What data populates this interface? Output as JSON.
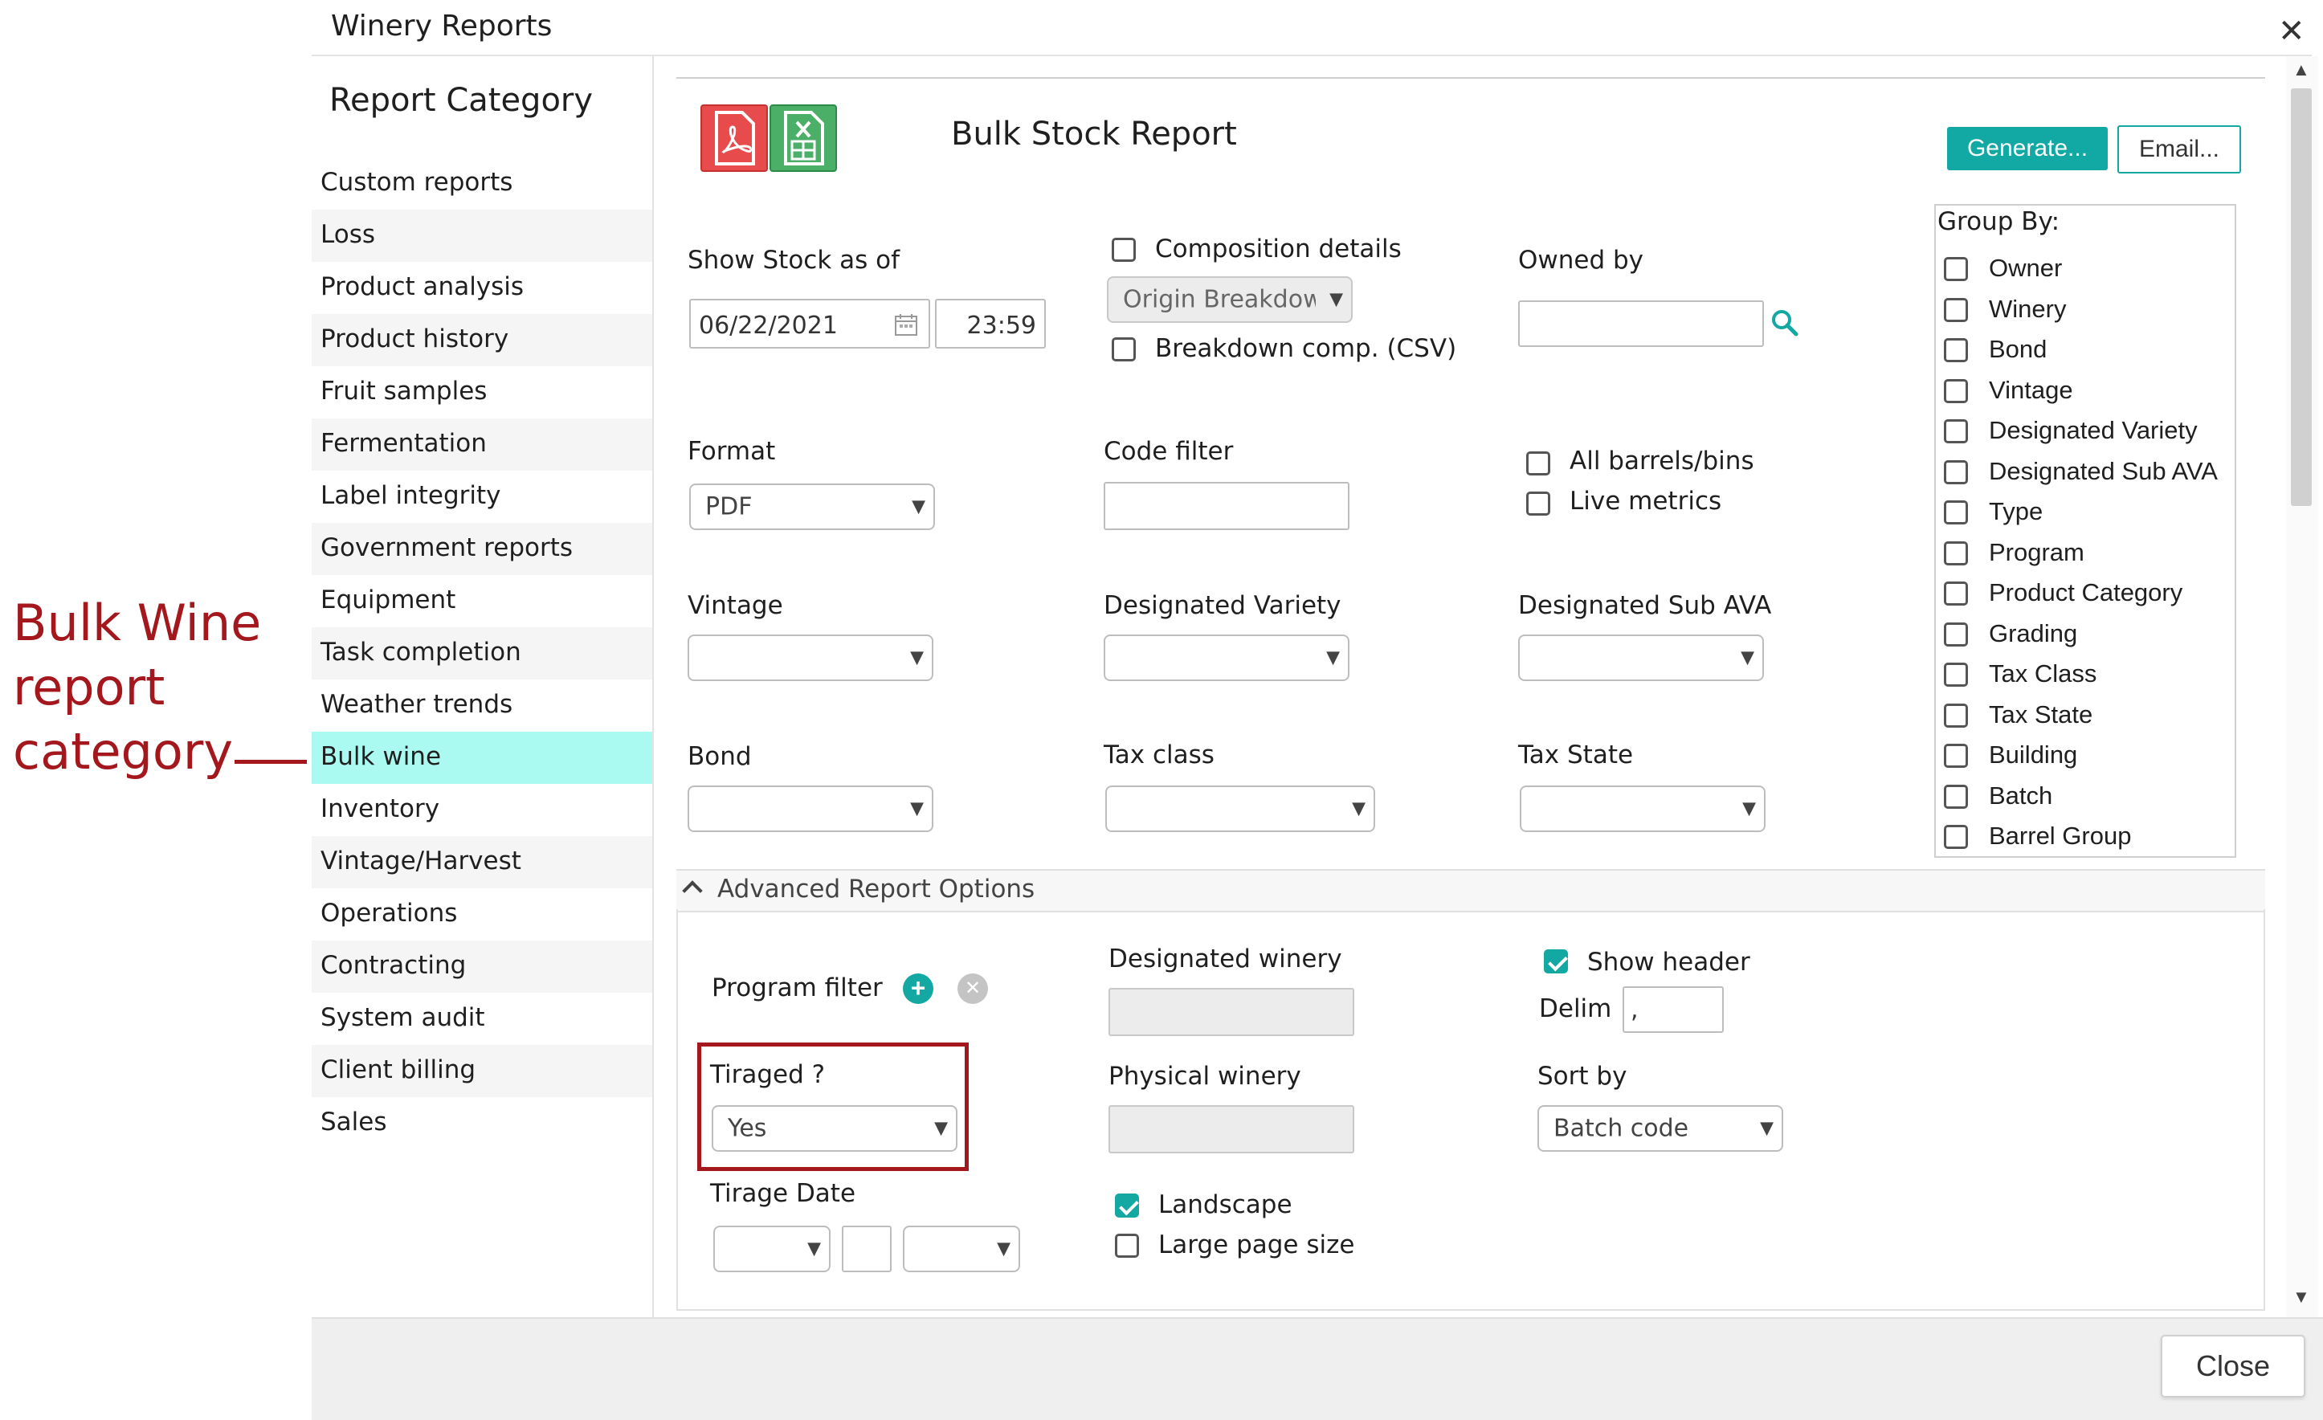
{
  "annotation": {
    "text": "Bulk Wine report category",
    "color": "#a3171d"
  },
  "dialog": {
    "title": "Winery Reports",
    "close_symbol": "✕"
  },
  "sidebar": {
    "heading": "Report Category",
    "items": [
      {
        "label": "Custom reports"
      },
      {
        "label": "Loss"
      },
      {
        "label": "Product analysis"
      },
      {
        "label": "Product history"
      },
      {
        "label": "Fruit samples"
      },
      {
        "label": "Fermentation"
      },
      {
        "label": "Label integrity"
      },
      {
        "label": "Government reports"
      },
      {
        "label": "Equipment"
      },
      {
        "label": "Task completion"
      },
      {
        "label": "Weather trends"
      },
      {
        "label": "Bulk wine",
        "active": true
      },
      {
        "label": "Inventory"
      },
      {
        "label": "Vintage/Harvest"
      },
      {
        "label": "Operations"
      },
      {
        "label": "Contracting"
      },
      {
        "label": "System audit"
      },
      {
        "label": "Client billing"
      },
      {
        "label": "Sales"
      }
    ],
    "active_color": "#aafaf2"
  },
  "report": {
    "title": "Bulk Stock Report",
    "icons": {
      "pdf": "pdf-file-icon",
      "excel": "excel-file-icon"
    },
    "generate_label": "Generate...",
    "email_label": "Email...",
    "accent_color": "#12a9a4"
  },
  "fields": {
    "show_stock_label": "Show Stock as of",
    "date_value": "06/22/2021",
    "time_value": "23:59",
    "composition_label": "Composition details",
    "origin_breakdown_value": "Origin Breakdown",
    "breakdown_csv_label": "Breakdown comp. (CSV)",
    "owned_by_label": "Owned by",
    "owned_by_value": "",
    "format_label": "Format",
    "format_value": "PDF",
    "code_filter_label": "Code filter",
    "code_filter_value": "",
    "all_barrels_label": "All barrels/bins",
    "live_metrics_label": "Live metrics",
    "vintage_label": "Vintage",
    "designated_variety_label": "Designated Variety",
    "designated_sub_ava_label": "Designated Sub AVA",
    "bond_label": "Bond",
    "tax_class_label": "Tax class",
    "tax_state_label": "Tax State"
  },
  "group_by": {
    "heading": "Group By:",
    "items": [
      "Owner",
      "Winery",
      "Bond",
      "Vintage",
      "Designated Variety",
      "Designated Sub AVA",
      "Type",
      "Program",
      "Product Category",
      "Grading",
      "Tax Class",
      "Tax State",
      "Building",
      "Batch",
      "Barrel Group"
    ]
  },
  "advanced": {
    "toggle_label": "Advanced Report Options",
    "program_filter_label": "Program filter",
    "tiraged_label": "Tiraged ?",
    "tiraged_value": "Yes",
    "tirage_date_label": "Tirage Date",
    "designated_winery_label": "Designated winery",
    "physical_winery_label": "Physical winery",
    "landscape_label": "Landscape",
    "landscape_checked": true,
    "large_page_label": "Large page size",
    "show_header_label": "Show header",
    "show_header_checked": true,
    "delim_label": "Delim",
    "delim_value": ",",
    "sort_by_label": "Sort by",
    "sort_by_value": "Batch code"
  },
  "footer": {
    "close_label": "Close"
  }
}
